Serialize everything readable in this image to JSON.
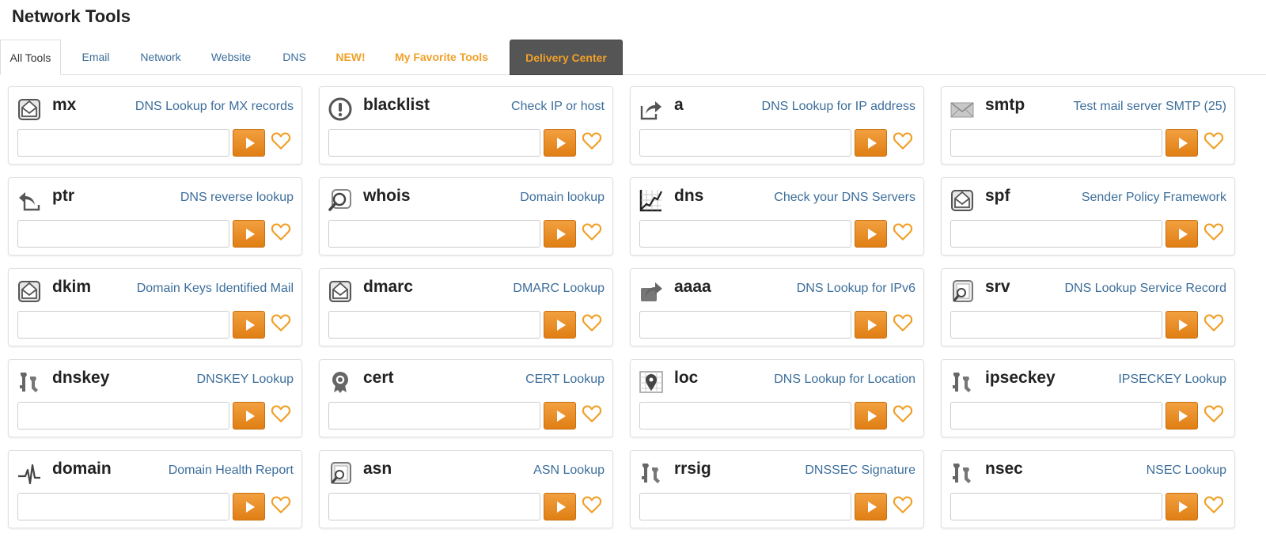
{
  "page": {
    "title": "Network Tools"
  },
  "colors": {
    "accent": "#f0a028",
    "link": "#3c6e9b",
    "button": "#e8891e",
    "dark_tab": "#555555"
  },
  "tabs": [
    {
      "label": "All Tools",
      "active": true
    },
    {
      "label": "Email"
    },
    {
      "label": "Network"
    },
    {
      "label": "Website"
    },
    {
      "label": "DNS"
    },
    {
      "label": "NEW!",
      "highlight": true
    },
    {
      "label": "My Favorite Tools",
      "highlight": true
    },
    {
      "label": "Delivery Center",
      "dark": true
    }
  ],
  "tools": [
    {
      "name": "mx",
      "desc": "DNS Lookup for MX records",
      "icon": "envelope-icon",
      "input": ""
    },
    {
      "name": "blacklist",
      "desc": "Check IP or host",
      "icon": "alert-icon",
      "input": ""
    },
    {
      "name": "a",
      "desc": "DNS Lookup for IP address",
      "icon": "share-arrow-icon",
      "input": ""
    },
    {
      "name": "smtp",
      "desc": "Test mail server SMTP (25)",
      "icon": "mail-icon",
      "input": ""
    },
    {
      "name": "ptr",
      "desc": "DNS reverse lookup",
      "icon": "reply-arrow-icon",
      "input": ""
    },
    {
      "name": "whois",
      "desc": "Domain lookup",
      "icon": "magnifier-icon",
      "input": ""
    },
    {
      "name": "dns",
      "desc": "Check your DNS Servers",
      "icon": "line-chart-icon",
      "input": ""
    },
    {
      "name": "spf",
      "desc": "Sender Policy Framework",
      "icon": "envelope-icon",
      "input": ""
    },
    {
      "name": "dkim",
      "desc": "Domain Keys Identified Mail",
      "icon": "envelope-icon",
      "input": ""
    },
    {
      "name": "dmarc",
      "desc": "DMARC Lookup",
      "icon": "envelope-icon",
      "input": ""
    },
    {
      "name": "aaaa",
      "desc": "DNS Lookup for IPv6",
      "icon": "share-arrow-filled-icon",
      "input": ""
    },
    {
      "name": "srv",
      "desc": "DNS Lookup Service Record",
      "icon": "server-search-icon",
      "input": ""
    },
    {
      "name": "dnskey",
      "desc": "DNSKEY Lookup",
      "icon": "keys-icon",
      "input": ""
    },
    {
      "name": "cert",
      "desc": "CERT Lookup",
      "icon": "badge-icon",
      "input": ""
    },
    {
      "name": "loc",
      "desc": "DNS Lookup for Location",
      "icon": "map-pin-icon",
      "input": ""
    },
    {
      "name": "ipseckey",
      "desc": "IPSECKEY Lookup",
      "icon": "keys-icon",
      "input": ""
    },
    {
      "name": "domain",
      "desc": "Domain Health Report",
      "icon": "pulse-icon",
      "input": ""
    },
    {
      "name": "asn",
      "desc": "ASN Lookup",
      "icon": "server-search-icon",
      "input": ""
    },
    {
      "name": "rrsig",
      "desc": "DNSSEC Signature",
      "icon": "keys-icon",
      "input": ""
    },
    {
      "name": "nsec",
      "desc": "NSEC Lookup",
      "icon": "keys-icon",
      "input": ""
    }
  ]
}
